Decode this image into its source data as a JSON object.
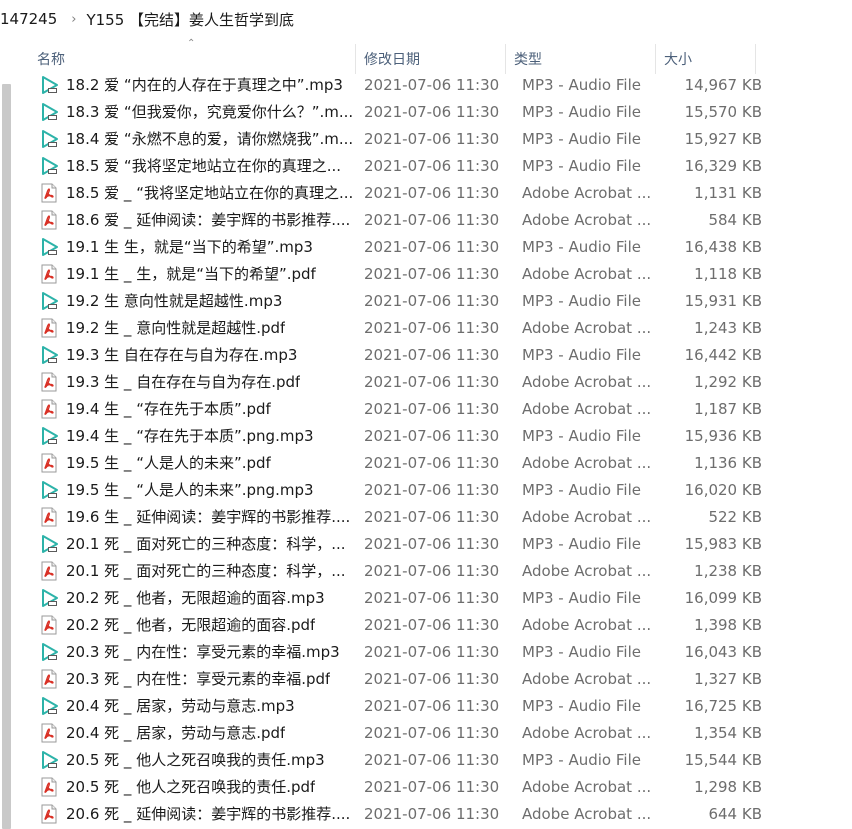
{
  "breadcrumb": {
    "parent": "147245",
    "current": "Y155 【完结】姜人生哲学到底"
  },
  "columns": {
    "name": "名称",
    "date": "修改日期",
    "type": "类型",
    "size": "大小"
  },
  "rows": [
    {
      "name": "18.2 爱 “内在的人存在于真理之中”.mp3",
      "date": "2021-07-06 11:30",
      "type": "MP3 - Audio File",
      "size": "14,967 KB",
      "icon": "mp3-icon"
    },
    {
      "name": "18.3 爱 “但我爱你，究竟爱你什么？”.m...",
      "date": "2021-07-06 11:30",
      "type": "MP3 - Audio File",
      "size": "15,570 KB",
      "icon": "mp3-icon"
    },
    {
      "name": "18.4 爱 “永燃不息的爱，请你燃烧我”.m...",
      "date": "2021-07-06 11:30",
      "type": "MP3 - Audio File",
      "size": "15,927 KB",
      "icon": "mp3-icon"
    },
    {
      "name": "18.5 爱 “我将坚定地站立在你的真理之...",
      "date": "2021-07-06 11:30",
      "type": "MP3 - Audio File",
      "size": "16,329 KB",
      "icon": "mp3-icon"
    },
    {
      "name": "18.5 爱 _ “我将坚定地站立在你的真理之...",
      "date": "2021-07-06 11:30",
      "type": "Adobe Acrobat ...",
      "size": "1,131 KB",
      "icon": "pdf-icon"
    },
    {
      "name": "18.6 爱 _ 延伸阅读：姜宇辉的书影推荐....",
      "date": "2021-07-06 11:30",
      "type": "Adobe Acrobat ...",
      "size": "584 KB",
      "icon": "pdf-icon"
    },
    {
      "name": "19.1 生 生，就是“当下的希望”.mp3",
      "date": "2021-07-06 11:30",
      "type": "MP3 - Audio File",
      "size": "16,438 KB",
      "icon": "mp3-icon"
    },
    {
      "name": "19.1 生 _ 生，就是“当下的希望”.pdf",
      "date": "2021-07-06 11:30",
      "type": "Adobe Acrobat ...",
      "size": "1,118 KB",
      "icon": "pdf-icon"
    },
    {
      "name": "19.2 生 意向性就是超越性.mp3",
      "date": "2021-07-06 11:30",
      "type": "MP3 - Audio File",
      "size": "15,931 KB",
      "icon": "mp3-icon"
    },
    {
      "name": "19.2 生 _ 意向性就是超越性.pdf",
      "date": "2021-07-06 11:30",
      "type": "Adobe Acrobat ...",
      "size": "1,243 KB",
      "icon": "pdf-icon"
    },
    {
      "name": "19.3 生 自在存在与自为存在.mp3",
      "date": "2021-07-06 11:30",
      "type": "MP3 - Audio File",
      "size": "16,442 KB",
      "icon": "mp3-icon"
    },
    {
      "name": "19.3 生 _ 自在存在与自为存在.pdf",
      "date": "2021-07-06 11:30",
      "type": "Adobe Acrobat ...",
      "size": "1,292 KB",
      "icon": "pdf-icon"
    },
    {
      "name": "19.4 生 _ “存在先于本质”.pdf",
      "date": "2021-07-06 11:30",
      "type": "Adobe Acrobat ...",
      "size": "1,187 KB",
      "icon": "pdf-icon"
    },
    {
      "name": "19.4 生 _ “存在先于本质”.png.mp3",
      "date": "2021-07-06 11:30",
      "type": "MP3 - Audio File",
      "size": "15,936 KB",
      "icon": "mp3-icon"
    },
    {
      "name": "19.5 生 _ “人是人的未来”.pdf",
      "date": "2021-07-06 11:30",
      "type": "Adobe Acrobat ...",
      "size": "1,136 KB",
      "icon": "pdf-icon"
    },
    {
      "name": "19.5 生 _ “人是人的未来”.png.mp3",
      "date": "2021-07-06 11:30",
      "type": "MP3 - Audio File",
      "size": "16,020 KB",
      "icon": "mp3-icon"
    },
    {
      "name": "19.6 生 _ 延伸阅读：姜宇辉的书影推荐....",
      "date": "2021-07-06 11:30",
      "type": "Adobe Acrobat ...",
      "size": "522 KB",
      "icon": "pdf-icon"
    },
    {
      "name": "20.1 死 _ 面对死亡的三种态度：科学，...",
      "date": "2021-07-06 11:30",
      "type": "MP3 - Audio File",
      "size": "15,983 KB",
      "icon": "mp3-icon"
    },
    {
      "name": "20.1 死 _ 面对死亡的三种态度：科学，...",
      "date": "2021-07-06 11:30",
      "type": "Adobe Acrobat ...",
      "size": "1,238 KB",
      "icon": "pdf-icon"
    },
    {
      "name": "20.2 死 _ 他者，无限超逾的面容.mp3",
      "date": "2021-07-06 11:30",
      "type": "MP3 - Audio File",
      "size": "16,099 KB",
      "icon": "mp3-icon"
    },
    {
      "name": "20.2 死 _ 他者，无限超逾的面容.pdf",
      "date": "2021-07-06 11:30",
      "type": "Adobe Acrobat ...",
      "size": "1,398 KB",
      "icon": "pdf-icon"
    },
    {
      "name": "20.3 死 _ 内在性：享受元素的幸福.mp3",
      "date": "2021-07-06 11:30",
      "type": "MP3 - Audio File",
      "size": "16,043 KB",
      "icon": "mp3-icon"
    },
    {
      "name": "20.3 死 _ 内在性：享受元素的幸福.pdf",
      "date": "2021-07-06 11:30",
      "type": "Adobe Acrobat ...",
      "size": "1,327 KB",
      "icon": "pdf-icon"
    },
    {
      "name": "20.4 死 _ 居家，劳动与意志.mp3",
      "date": "2021-07-06 11:30",
      "type": "MP3 - Audio File",
      "size": "16,725 KB",
      "icon": "mp3-icon"
    },
    {
      "name": "20.4 死 _ 居家，劳动与意志.pdf",
      "date": "2021-07-06 11:30",
      "type": "Adobe Acrobat ...",
      "size": "1,354 KB",
      "icon": "pdf-icon"
    },
    {
      "name": "20.5 死 _ 他人之死召唤我的责任.mp3",
      "date": "2021-07-06 11:30",
      "type": "MP3 - Audio File",
      "size": "15,544 KB",
      "icon": "mp3-icon"
    },
    {
      "name": "20.5 死 _ 他人之死召唤我的责任.pdf",
      "date": "2021-07-06 11:30",
      "type": "Adobe Acrobat ...",
      "size": "1,298 KB",
      "icon": "pdf-icon"
    },
    {
      "name": "20.6 死 _ 延伸阅读：姜宇辉的书影推荐....",
      "date": "2021-07-06 11:30",
      "type": "Adobe Acrobat ...",
      "size": "644 KB",
      "icon": "pdf-icon"
    }
  ],
  "colors": {
    "mp3_icon": "#2db3a9",
    "pdf_icon": "#d93025",
    "header_text": "#4c607a",
    "meta_text": "#6d6d6d"
  }
}
